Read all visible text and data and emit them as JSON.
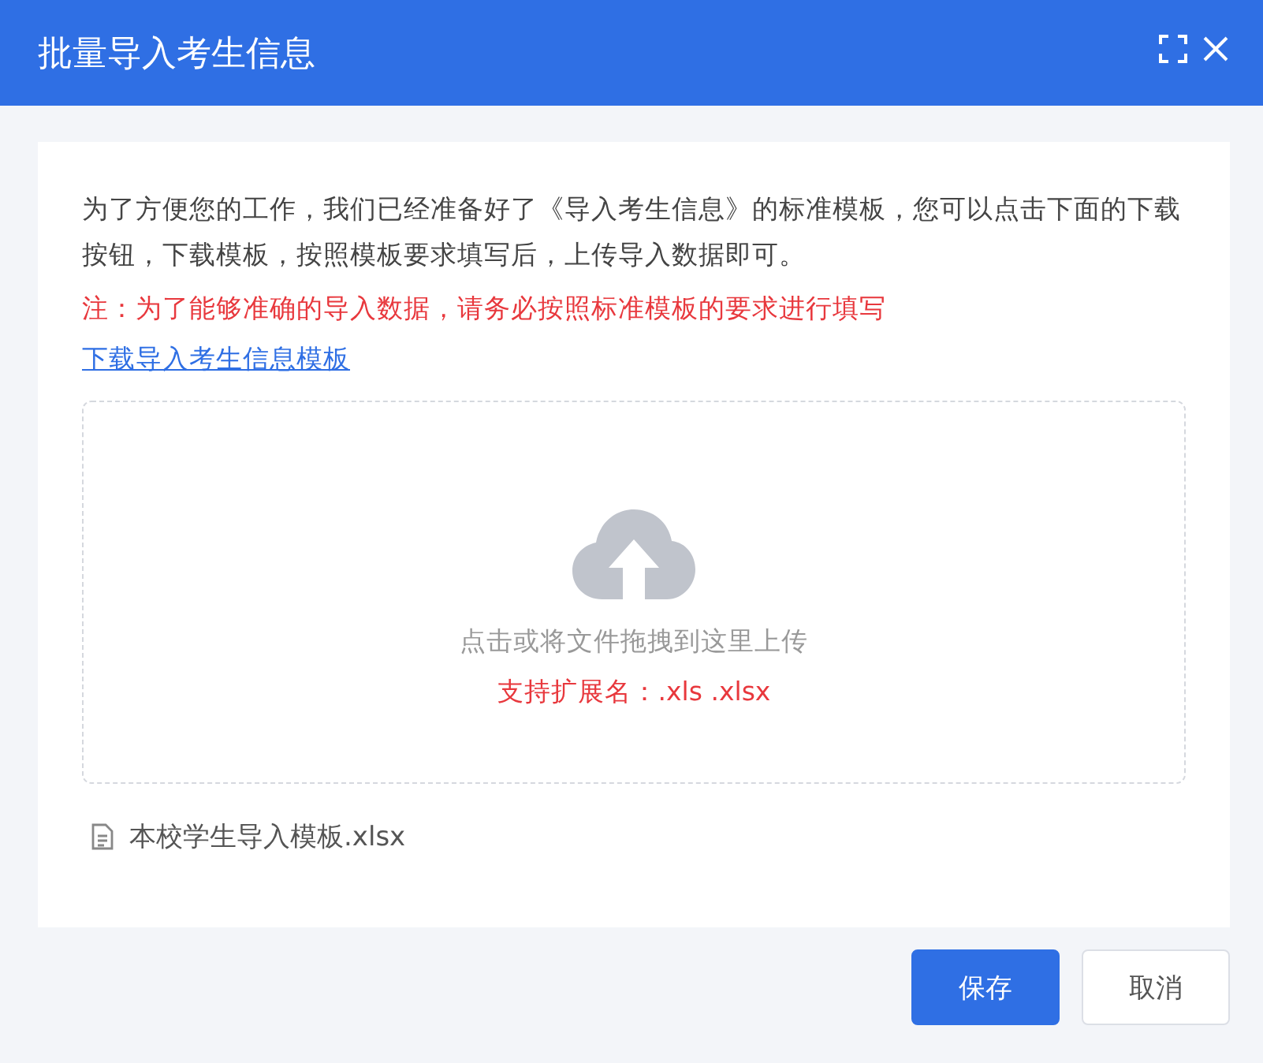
{
  "dialog": {
    "title": "批量导入考生信息"
  },
  "intro": "为了方便您的工作，我们已经准备好了《导入考生信息》的标准模板，您可以点击下面的下载按钮，下载模板，按照模板要求填写后，上传导入数据即可。",
  "note": "注：为了能够准确的导入数据，请务必按照标准模板的要求进行填写",
  "download_link": "下载导入考生信息模板",
  "upload": {
    "hint": "点击或将文件拖拽到这里上传",
    "extensions": "支持扩展名：.xls .xlsx"
  },
  "files": [
    {
      "name": "本校学生导入模板.xlsx"
    }
  ],
  "buttons": [
    {
      "label": "保存",
      "kind": "primary"
    },
    {
      "label": "取消",
      "kind": "default"
    }
  ]
}
